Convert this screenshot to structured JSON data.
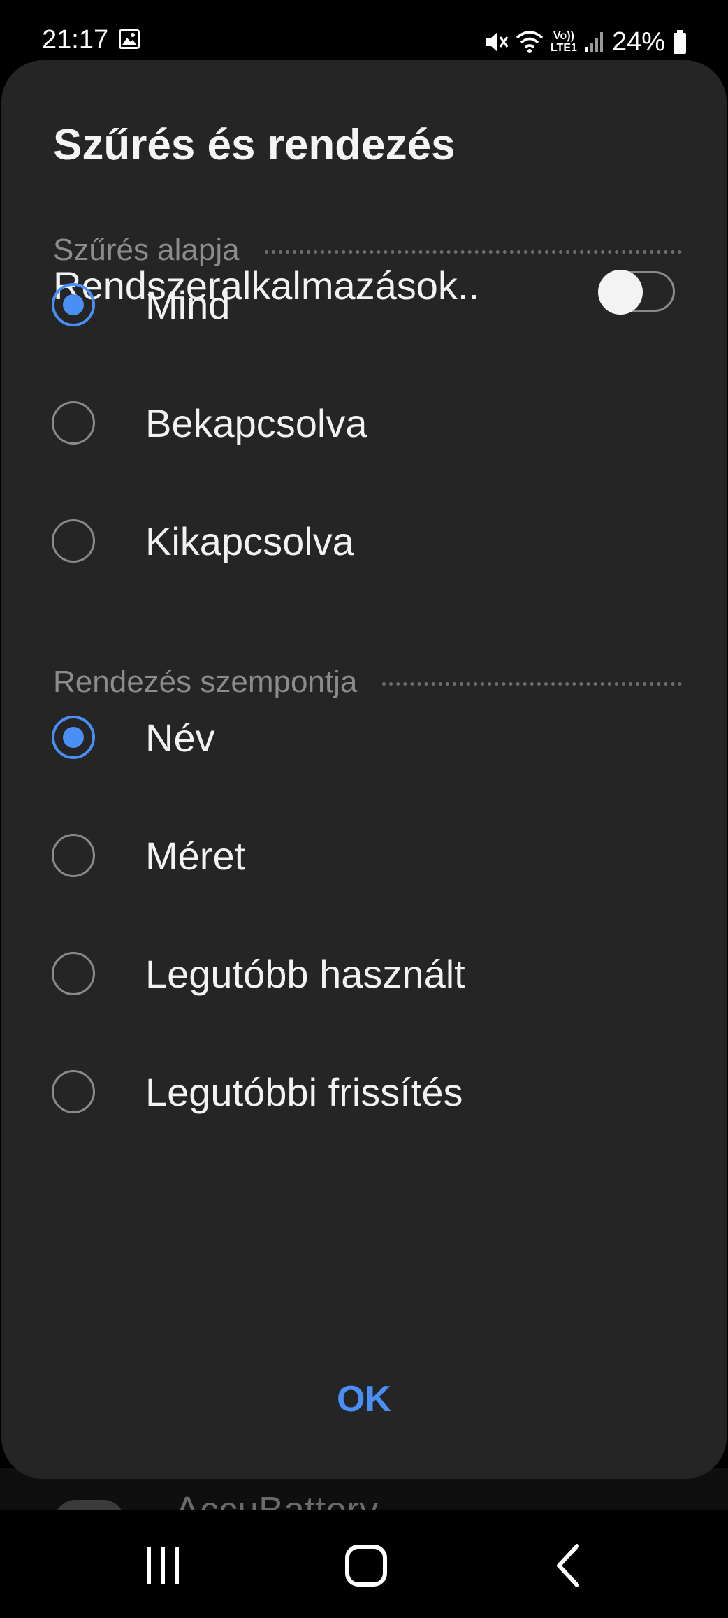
{
  "status_bar": {
    "time": "21:17",
    "battery_text": "24%",
    "icons": [
      "gallery-icon",
      "mute-icon",
      "wifi-icon",
      "volte-lte-icon",
      "signal-icon",
      "battery-icon"
    ],
    "volte_top": "Vo))",
    "volte_bottom": "LTE1"
  },
  "dialog": {
    "title": "Szűrés és rendezés",
    "system_apps": {
      "label": "Rendszeralkalmazások..",
      "enabled": false
    },
    "filter": {
      "header": "Szűrés alapja",
      "options": [
        {
          "label": "Mind",
          "checked": true
        },
        {
          "label": "Bekapcsolva",
          "checked": false
        },
        {
          "label": "Kikapcsolva",
          "checked": false
        }
      ]
    },
    "sort": {
      "header": "Rendezés szempontja",
      "options": [
        {
          "label": "Név",
          "checked": true
        },
        {
          "label": "Méret",
          "checked": false
        },
        {
          "label": "Legutóbb használt",
          "checked": false
        },
        {
          "label": "Legutóbbi frissítés",
          "checked": false
        }
      ]
    },
    "ok_label": "OK"
  },
  "background_peek": {
    "app_name": "AccuBattery"
  },
  "nav_bar": {
    "buttons": [
      "recents-icon",
      "home-icon",
      "back-icon"
    ]
  },
  "colors": {
    "accent": "#4a8ff5",
    "dialog_bg": "#252525",
    "background": "#000000"
  }
}
